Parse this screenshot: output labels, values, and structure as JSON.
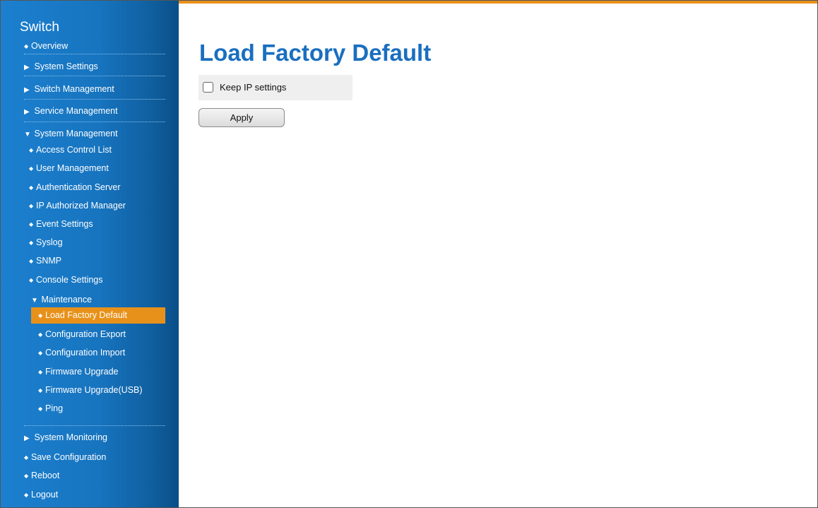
{
  "sidebar": {
    "brand": "Switch",
    "items": {
      "overview": "Overview",
      "system_settings": "System Settings",
      "switch_management": "Switch Management",
      "service_management": "Service Management",
      "system_management": "System Management",
      "access_control_list": "Access Control List",
      "user_management": "User Management",
      "authentication_server": "Authentication Server",
      "ip_authorized_manager": "IP Authorized Manager",
      "event_settings": "Event Settings",
      "syslog": "Syslog",
      "snmp": "SNMP",
      "console_settings": "Console Settings",
      "maintenance": "Maintenance",
      "load_factory_default": "Load Factory Default",
      "configuration_export": "Configuration Export",
      "configuration_import": "Configuration Import",
      "firmware_upgrade": "Firmware Upgrade",
      "firmware_upgrade_usb": "Firmware Upgrade(USB)",
      "ping": "Ping",
      "system_monitoring": "System Monitoring",
      "save_configuration": "Save Configuration",
      "reboot": "Reboot",
      "logout": "Logout"
    },
    "glyphs": {
      "bullet": "◆",
      "collapsed": "▶",
      "expanded": "▼"
    }
  },
  "main": {
    "title": "Load Factory Default",
    "keep_ip_label": "Keep IP settings",
    "keep_ip_checked": false,
    "apply_label": "Apply"
  },
  "colors": {
    "accent": "#e8911a",
    "title": "#1a6fbf",
    "sidebar": "#1774bf"
  }
}
